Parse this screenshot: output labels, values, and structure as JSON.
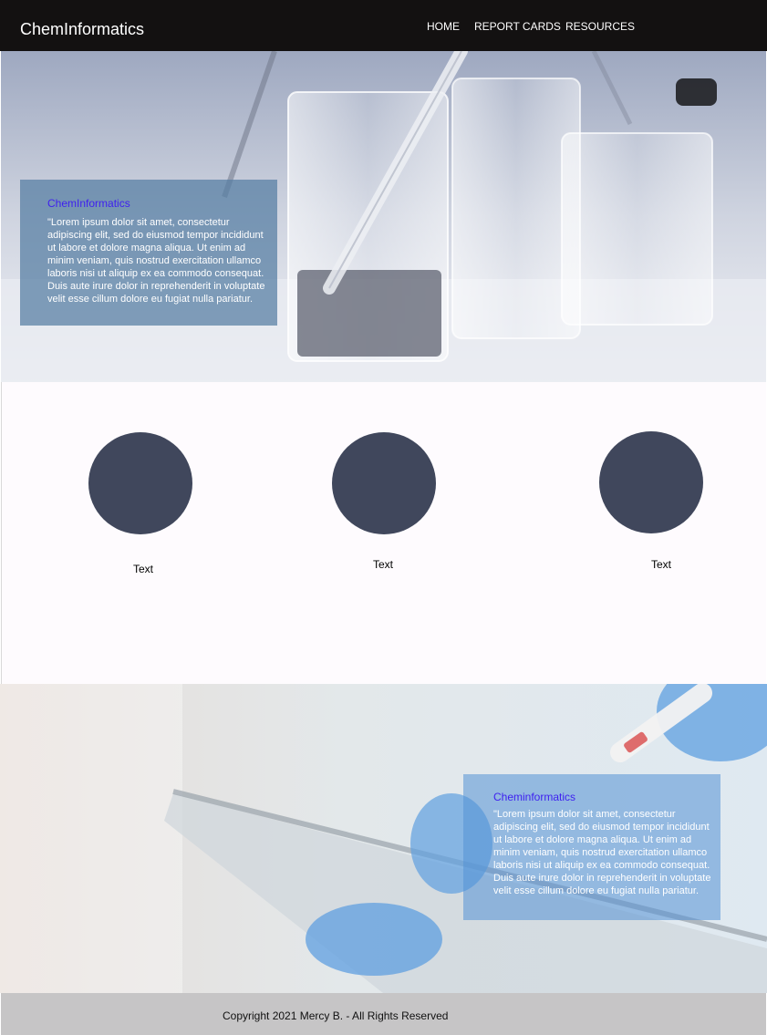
{
  "navbar": {
    "brand": "ChemInformatics",
    "links": [
      {
        "label": "HOME"
      },
      {
        "label": "REPORT CARDS"
      },
      {
        "label": "RESOURCES"
      }
    ]
  },
  "hero": {
    "panel_title": "ChemInformatics",
    "panel_text": "\"Lorem ipsum dolor sit amet, consectetur adipiscing elit, sed do eiusmod tempor incididunt ut labore et dolore magna aliqua. Ut enim ad minim veniam, quis nostrud exercitation ullamco laboris nisi ut aliquip ex ea commodo consequat. Duis aute irure dolor in reprehenderit in voluptate velit esse cillum dolore eu fugiat nulla pariatur."
  },
  "features": {
    "items": [
      {
        "label": "Text"
      },
      {
        "label": "Text"
      },
      {
        "label": "Text"
      }
    ]
  },
  "lab": {
    "panel_title": "Cheminformatics",
    "panel_text": "\"Lorem ipsum dolor sit amet, consectetur adipiscing elit, sed do eiusmod tempor incididunt ut labore et dolore magna aliqua. Ut enim ad minim veniam, quis nostrud exercitation ullamco laboris nisi ut aliquip ex ea commodo consequat. Duis aute irure dolor in reprehenderit in voluptate velit esse cillum dolore eu fugiat nulla pariatur."
  },
  "footer": {
    "copyright": "Copyright 2021 Mercy B. - All Rights Reserved"
  },
  "colors": {
    "navbar_bg": "#131111",
    "accent_title": "#3e1ff0",
    "circle_fill": "#40475c",
    "footer_bg": "#c6c5c6"
  }
}
